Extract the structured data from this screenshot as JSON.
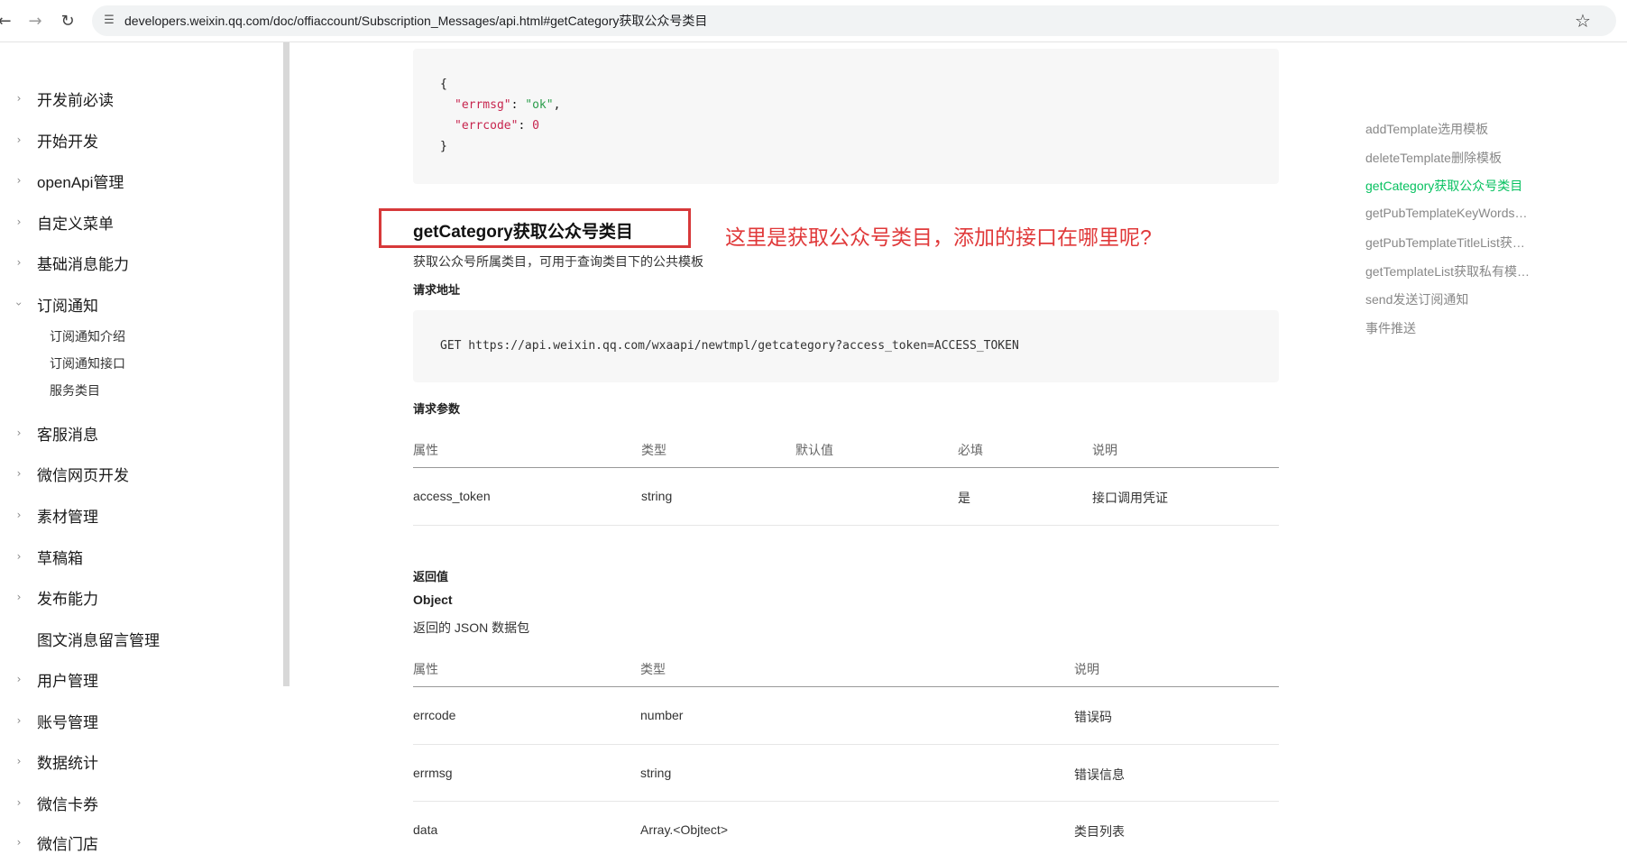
{
  "browser": {
    "url": "developers.weixin.qq.com/doc/offiaccount/Subscription_Messages/api.html#getCategory获取公众号类目"
  },
  "sidebar": {
    "items": [
      {
        "label": "开发前必读",
        "expanded": false
      },
      {
        "label": "开始开发",
        "expanded": false
      },
      {
        "label": "openApi管理",
        "expanded": false
      },
      {
        "label": "自定义菜单",
        "expanded": false
      },
      {
        "label": "基础消息能力",
        "expanded": false
      },
      {
        "label": "订阅通知",
        "expanded": true
      },
      {
        "label": "客服消息",
        "expanded": false
      },
      {
        "label": "微信网页开发",
        "expanded": false
      },
      {
        "label": "素材管理",
        "expanded": false
      },
      {
        "label": "草稿箱",
        "expanded": false
      },
      {
        "label": "发布能力",
        "expanded": false
      },
      {
        "label": "图文消息留言管理",
        "expanded": false
      },
      {
        "label": "用户管理",
        "expanded": false
      },
      {
        "label": "账号管理",
        "expanded": false
      },
      {
        "label": "数据统计",
        "expanded": false
      },
      {
        "label": "微信卡券",
        "expanded": false
      },
      {
        "label": "微信门店",
        "expanded": false
      }
    ],
    "sub_items": [
      "订阅通知介绍",
      "订阅通知接口",
      "服务类目"
    ]
  },
  "code_top": {
    "open": "{",
    "line1_key": "\"errmsg\"",
    "line1_val": "\"ok\"",
    "line2_key": "\"errcode\"",
    "line2_val": "0",
    "close": "}"
  },
  "section": {
    "title": "getCategory获取公众号类目",
    "annotation": "这里是获取公众号类目，添加的接口在哪里呢?",
    "description": "获取公众号所属类目，可用于查询类目下的公共模板",
    "request_url_label": "请求地址",
    "request_url": "GET https://api.weixin.qq.com/wxaapi/newtmpl/getcategory?access_token=ACCESS_TOKEN",
    "params_label": "请求参数",
    "params_headers": [
      "属性",
      "类型",
      "默认值",
      "必填",
      "说明"
    ],
    "params_rows": [
      {
        "name": "access_token",
        "type": "string",
        "default": "",
        "required": "是",
        "desc": "接口调用凭证"
      }
    ],
    "return_label": "返回值",
    "return_type": "Object",
    "return_desc": "返回的 JSON 数据包",
    "return_headers": [
      "属性",
      "类型",
      "说明"
    ],
    "return_rows": [
      {
        "name": "errcode",
        "type": "number",
        "desc": "错误码"
      },
      {
        "name": "errmsg",
        "type": "string",
        "desc": "错误信息"
      },
      {
        "name": "data",
        "type": "Array.<Objtect>",
        "desc": "类目列表"
      }
    ]
  },
  "toc": {
    "items": [
      {
        "label": "addTemplate选用模板",
        "active": false
      },
      {
        "label": "deleteTemplate删除模板",
        "active": false
      },
      {
        "label": "getCategory获取公众号类目",
        "active": true
      },
      {
        "label": "getPubTemplateKeyWords…",
        "active": false
      },
      {
        "label": "getPubTemplateTitleList获…",
        "active": false
      },
      {
        "label": "getTemplateList获取私有模…",
        "active": false
      },
      {
        "label": "send发送订阅通知",
        "active": false
      },
      {
        "label": "事件推送",
        "active": false
      }
    ],
    "active_color": "#07c160"
  },
  "colors": {
    "annotation_red": "#e0393a"
  },
  "icons": {
    "back": "arrow-left",
    "forward": "arrow-right",
    "reload": "reload",
    "site_info": "tune",
    "bookmark": "star-outline"
  }
}
